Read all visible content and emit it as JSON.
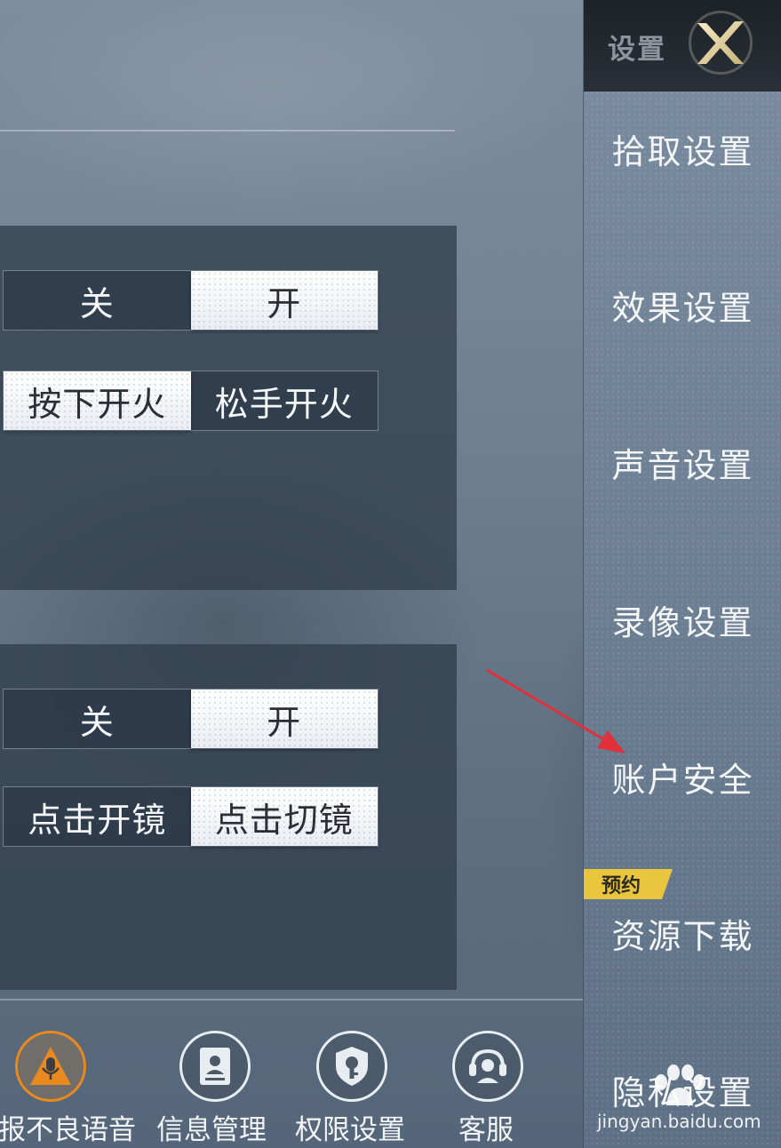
{
  "settings_panel": {
    "toggle_group_1": {
      "row_1": {
        "options": [
          "关",
          "开"
        ],
        "selected": "开"
      },
      "row_2": {
        "options": [
          "按下开火",
          "松手开火"
        ],
        "selected": "按下开火"
      }
    },
    "toggle_group_2": {
      "row_1": {
        "options": [
          "关",
          "开"
        ],
        "selected": "开"
      },
      "row_2": {
        "options": [
          "点击开镜",
          "点击切镜"
        ],
        "selected": "点击切镜"
      }
    }
  },
  "bottom_bar": {
    "items": [
      {
        "label": "报不良语音",
        "icon": "microphone-warning-icon",
        "accent": "#e88a1f"
      },
      {
        "label": "信息管理",
        "icon": "id-card-icon"
      },
      {
        "label": "权限设置",
        "icon": "shield-key-icon"
      },
      {
        "label": "客服",
        "icon": "headset-icon"
      }
    ]
  },
  "sidebar": {
    "title": "设置",
    "close_icon": "close-x-icon",
    "items": [
      {
        "label": "拾取设置"
      },
      {
        "label": "效果设置"
      },
      {
        "label": "声音设置"
      },
      {
        "label": "录像设置"
      },
      {
        "label": "账户安全"
      },
      {
        "label": "资源下载",
        "badge": "预约"
      },
      {
        "label": "隐私设置"
      }
    ]
  },
  "annotation": {
    "type": "red-arrow",
    "color": "#e0303a"
  },
  "watermark": {
    "brand": "Baidu",
    "text": "jingyan.baidu.com"
  }
}
